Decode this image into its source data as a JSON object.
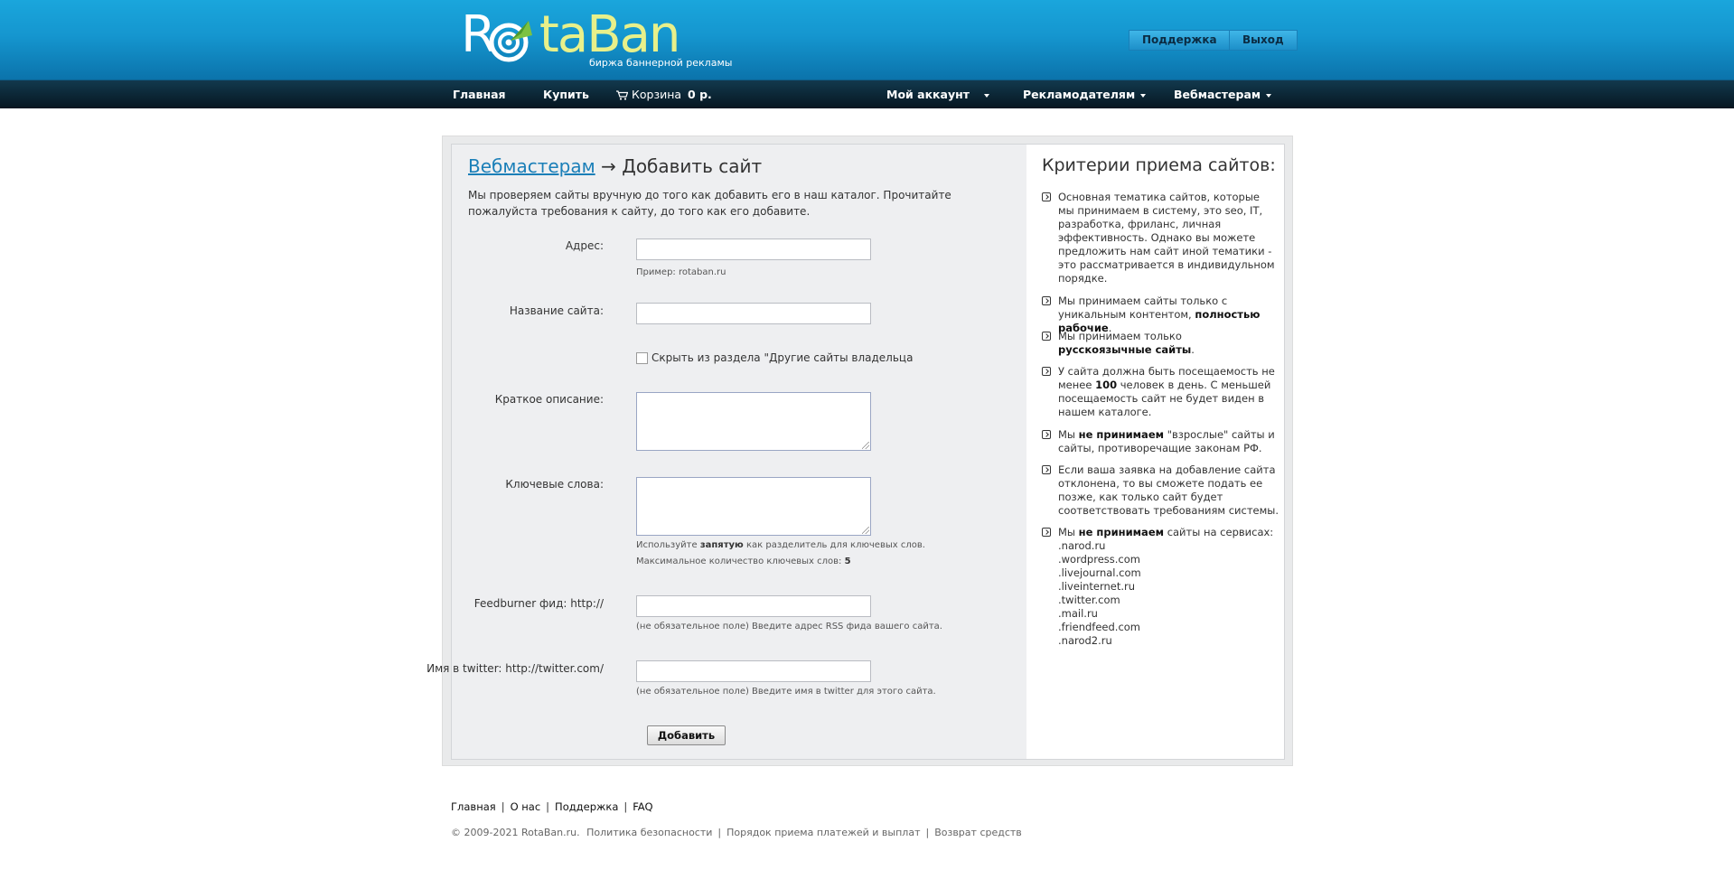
{
  "brand": {
    "logo_part1": "R",
    "logo_part2": "taBan",
    "tagline": "биржа баннерной рекламы",
    "accent_color": "#e8f08a",
    "header_color": "#1596cf"
  },
  "header_buttons": {
    "support": "Поддержка",
    "logout": "Выход"
  },
  "nav": {
    "home": "Главная",
    "buy": "Купить",
    "cart_label": "Корзина",
    "cart_amount": "0 р.",
    "account": "Мой аккаунт",
    "advertisers": "Рекламодателям",
    "webmasters": "Вебмастерам"
  },
  "page": {
    "breadcrumb_link": "Вебмастерам",
    "breadcrumb_arrow": "→",
    "title": "Добавить сайт",
    "intro": "Мы проверяем сайты вручную до того как добавить его в наш каталог. Прочитайте пожалуйста требования к сайту, до того как его добавите."
  },
  "form": {
    "address_label": "Адрес:",
    "address_value": "",
    "address_hint": "Пример: rotaban.ru",
    "name_label": "Название сайта:",
    "name_value": "",
    "hide_label": "Скрыть из раздела \"Другие сайты владельца",
    "hide_checked": false,
    "desc_label": "Краткое описание:",
    "desc_value": "",
    "keywords_label": "Ключевые слова:",
    "keywords_value": "",
    "keywords_hint1_pre": "Используйте",
    "keywords_hint1_bold": "запятую",
    "keywords_hint1_post": "как разделитель для ключевых слов.",
    "keywords_hint2_pre": "Максимальное количество ключевых слов:",
    "keywords_hint2_bold": "5",
    "feed_label": "Feedburner фид: http://",
    "feed_value": "",
    "feed_hint": "(не обязательное поле) Введите адрес RSS фида вашего сайта.",
    "twitter_label": "Имя в twitter: http://twitter.com/",
    "twitter_value": "",
    "twitter_hint": "(не обязательное поле) Введите имя в twitter для этого сайта.",
    "submit_label": "Добавить"
  },
  "criteria": {
    "title": "Критерии приема сайтов:",
    "c1": "Основная тематика сайтов, которые мы принимаем в систему, это seo, IT, разработка, фриланс, личная эффективность. Однако вы можете предложить нам сайт иной тематики - это рассматривается в индивидульном порядке.",
    "c2_pre": "Мы принимаем сайты только с уникальным контентом,",
    "c2_bold": "полностью рабочие",
    "c2_post": ".",
    "c3_pre": "Мы принимаем только",
    "c3_bold": "русскоязычные сайты",
    "c3_post": ".",
    "c4_pre": "У сайта должна быть посещаемость не менее",
    "c4_bold": "100",
    "c4_post": "человек в день. С меньшей посещаемость сайт не будет виден в нашем каталоге.",
    "c5_pre": "Мы",
    "c5_bold": "не принимаем",
    "c5_post": "\"взрослые\" сайты и сайты, противоречащие законам РФ.",
    "c6": "Если ваша заявка на добавление сайта отклонена, то вы сможете подать ее позже, как только сайт будет соответствовать требованиям системы.",
    "c7_pre": "Мы",
    "c7_bold": "не принимаем",
    "c7_post": "сайты на сервисах:",
    "services": [
      ".narod.ru",
      ".wordpress.com",
      ".livejournal.com",
      ".liveinternet.ru",
      ".twitter.com",
      ".mail.ru",
      ".friendfeed.com",
      ".narod2.ru"
    ]
  },
  "footer": {
    "links": [
      "Главная",
      "О нас",
      "Поддержка",
      "FAQ"
    ],
    "copyright": "© 2009-2021 RotaBan.ru.",
    "privacy": "Политика безопасности",
    "payments": "Порядок приема платежей и выплат",
    "refund": "Возврат средств"
  }
}
